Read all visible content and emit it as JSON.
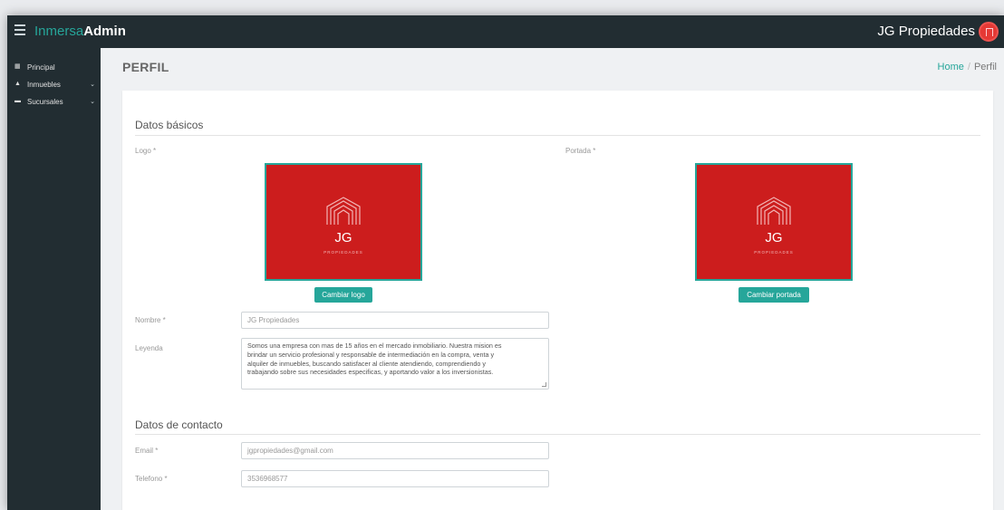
{
  "topbar": {
    "brand_part1": "Inmersa",
    "brand_part2": "Admin",
    "company_name": "JG Propiedades"
  },
  "sidebar": {
    "items": [
      {
        "label": "Principal",
        "icon": "grid-icon"
      },
      {
        "label": "Inmuebles",
        "icon": "home-icon",
        "expandable": true
      },
      {
        "label": "Sucursales",
        "icon": "briefcase-icon",
        "expandable": true
      }
    ]
  },
  "header": {
    "title": "PERFIL",
    "breadcrumb_home": "Home",
    "breadcrumb_separator": "/",
    "breadcrumb_current": "Perfil"
  },
  "basic": {
    "section_title": "Datos básicos",
    "logo_label": "Logo *",
    "cover_label": "Portada *",
    "logo_image": {
      "text": "JG",
      "subtext": "PROPIEDADES"
    },
    "cover_image": {
      "text": "JG",
      "subtext": "PROPIEDADES"
    },
    "change_logo_button": "Cambiar logo",
    "change_cover_button": "Cambiar portada",
    "name_label": "Nombre *",
    "name_value": "JG Propiedades",
    "legend_label": "Leyenda",
    "legend_lines": [
      "Somos una empresa con mas de 15 años en el mercado inmobiliario. Nuestra mision es",
      "brindar un servicio profesional y responsable de intermediación en la compra, venta y",
      "alquiler de inmuebles, buscando satisfacer al cliente atendiendo, comprendiendo y",
      "trabajando sobre sus necesidades especificas, y aportando valor a los inversionistas."
    ]
  },
  "contact": {
    "section_title": "Datos de contacto",
    "email_label": "Email *",
    "email_value": "jgpropiedades@gmail.com",
    "phone_label": "Telefono *",
    "phone_value": "3536968577"
  },
  "colors": {
    "accent": "#26a69a",
    "sidebar_bg": "#222d32",
    "brand_red": "#cc1d1d",
    "avatar_red": "#e53935"
  }
}
